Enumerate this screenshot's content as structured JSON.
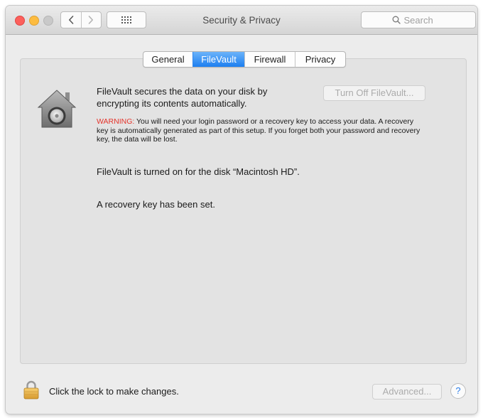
{
  "window": {
    "title": "Security & Privacy",
    "search": {
      "placeholder": "Search"
    }
  },
  "tabs": [
    {
      "label": "General",
      "active": false
    },
    {
      "label": "FileVault",
      "active": true
    },
    {
      "label": "Firewall",
      "active": false
    },
    {
      "label": "Privacy",
      "active": false
    }
  ],
  "filevault": {
    "description": "FileVault secures the data on your disk by encrypting its contents automatically.",
    "turn_off_label": "Turn Off FileVault...",
    "warning_label": "WARNING:",
    "warning_text": " You will need your login password or a recovery key to access your data. A recovery key is automatically generated as part of this setup. If you forget both your password and recovery key, the data will be lost.",
    "status_disk": "FileVault is turned on for the disk “Macintosh HD”.",
    "status_recovery": "A recovery key has been set."
  },
  "footer": {
    "lock_text": "Click the lock to make changes.",
    "advanced_label": "Advanced...",
    "help_label": "?"
  },
  "colors": {
    "accent": "#1d7ff0",
    "warning": "#e5332a",
    "close": "#fc605c",
    "minimize": "#fdbc40"
  },
  "icons": {
    "back": "chevron-left-icon",
    "forward": "chevron-right-icon",
    "grid": "grid-icon",
    "search": "magnifier-icon",
    "filevault": "house-safe-icon",
    "lock": "padlock-icon"
  }
}
